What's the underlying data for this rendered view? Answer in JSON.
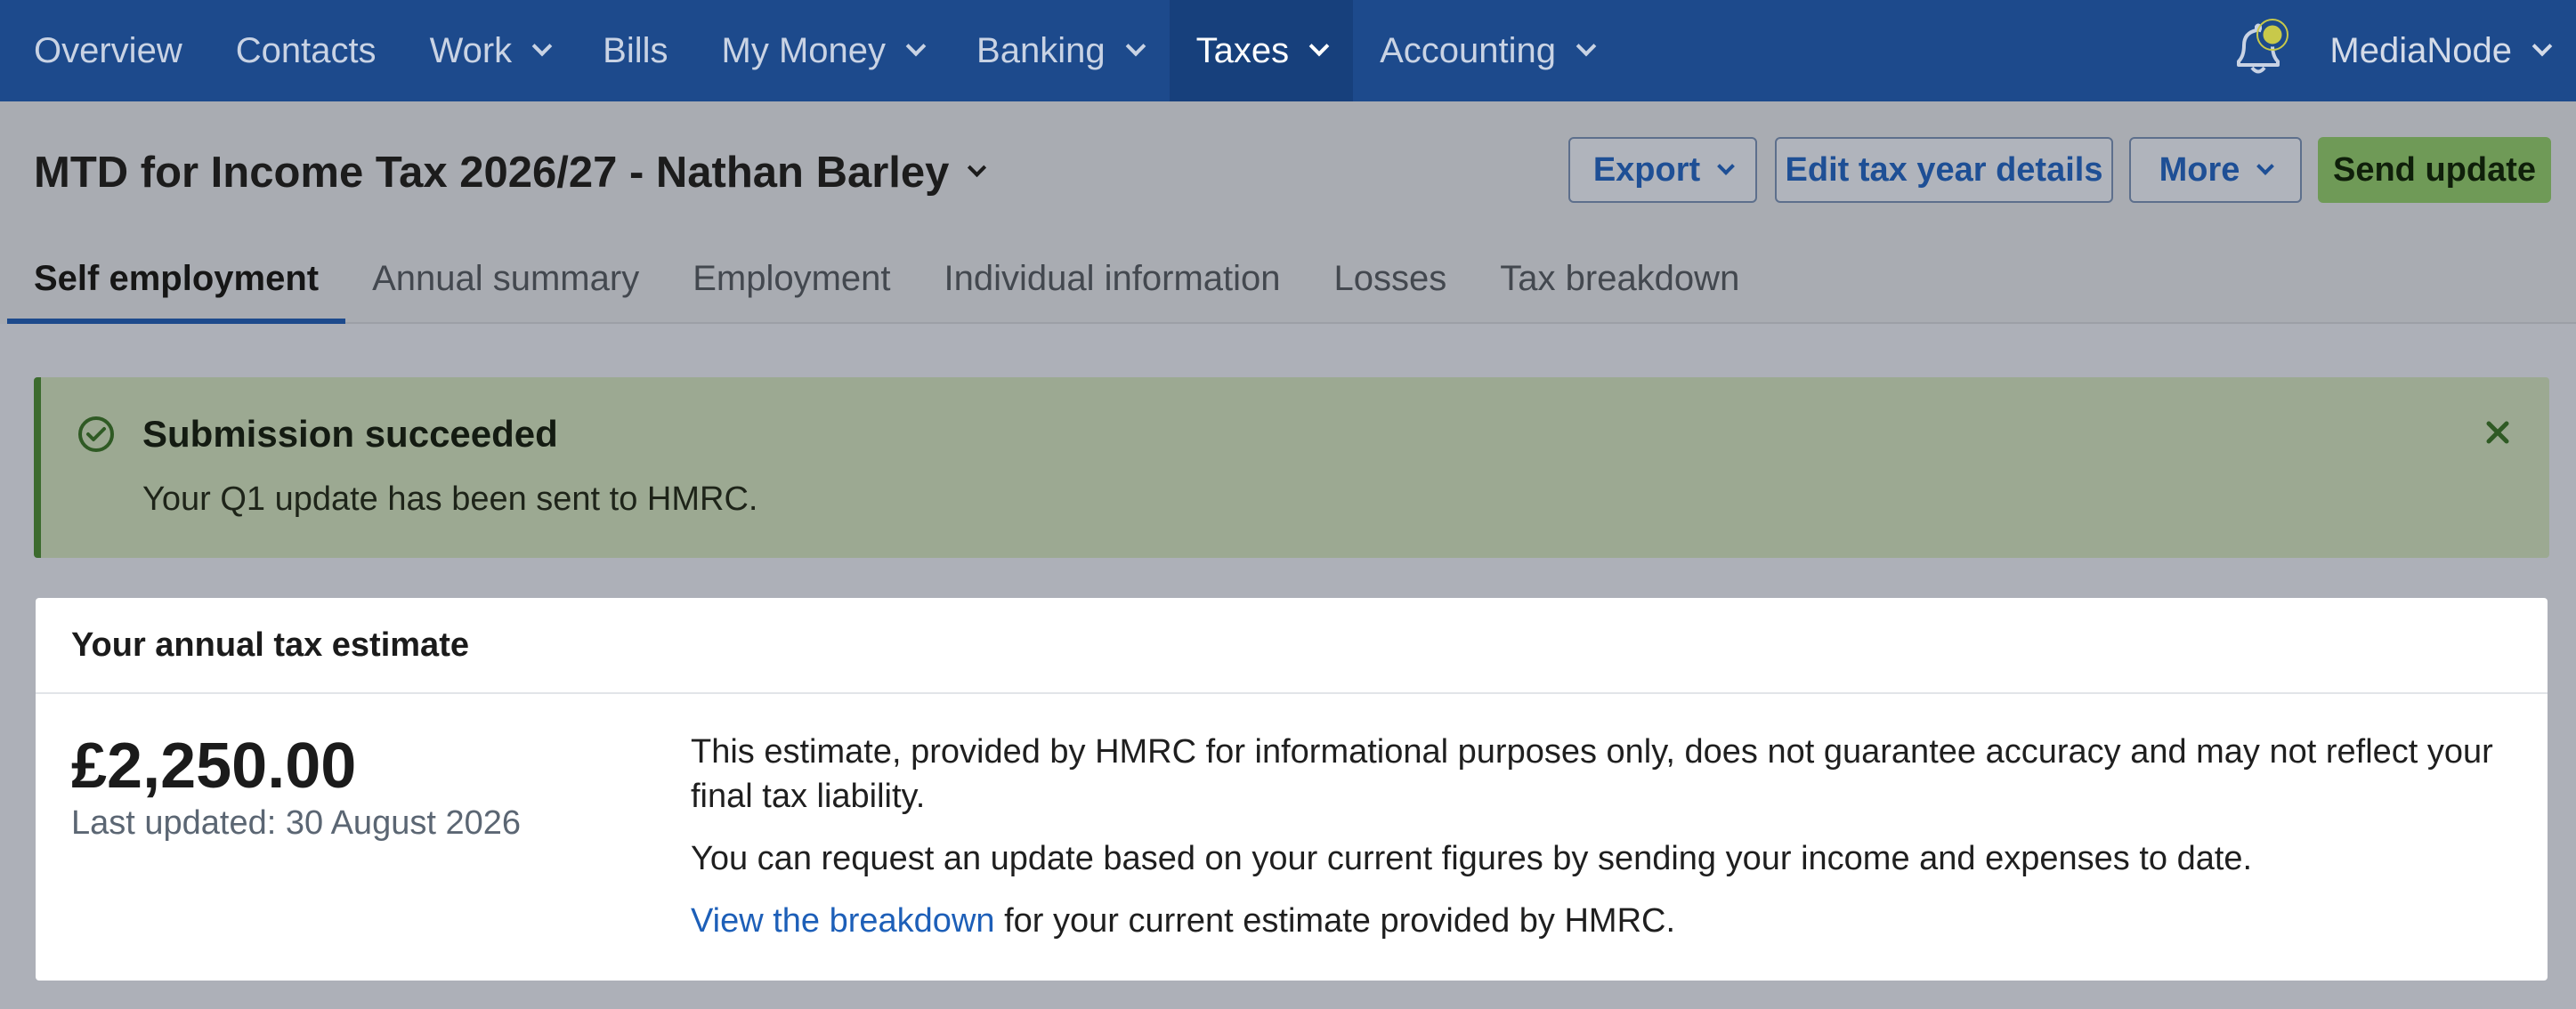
{
  "nav": {
    "items": [
      {
        "label": "Overview",
        "dropdown": false
      },
      {
        "label": "Contacts",
        "dropdown": false
      },
      {
        "label": "Work",
        "dropdown": true
      },
      {
        "label": "Bills",
        "dropdown": false
      },
      {
        "label": "My Money",
        "dropdown": true
      },
      {
        "label": "Banking",
        "dropdown": true
      },
      {
        "label": "Taxes",
        "dropdown": true,
        "active": true
      },
      {
        "label": "Accounting",
        "dropdown": true
      }
    ],
    "org_name": "MediaNode",
    "notification_icon": "bell-icon"
  },
  "header": {
    "title": "MTD for Income Tax 2026/27 - Nathan Barley",
    "export_label": "Export",
    "edit_label": "Edit tax year details",
    "more_label": "More",
    "send_label": "Send update"
  },
  "tabs": [
    {
      "label": "Self employment",
      "active": true
    },
    {
      "label": "Annual summary"
    },
    {
      "label": "Employment"
    },
    {
      "label": "Individual information"
    },
    {
      "label": "Losses"
    },
    {
      "label": "Tax breakdown"
    }
  ],
  "alert": {
    "title": "Submission succeeded",
    "message": "Your Q1 update has been sent to HMRC."
  },
  "estimate": {
    "heading": "Your annual tax estimate",
    "amount": "£2,250.00",
    "last_updated": "Last updated: 30 August 2026",
    "disclaimer": "This estimate, provided by HMRC for informational purposes only, does not guarantee accuracy and may not reflect your final tax liability.",
    "request_text": "You can request an update based on your current figures by sending your income and expenses to date.",
    "breakdown_link": "View the breakdown",
    "breakdown_suffix": " for your current estimate provided by HMRC."
  },
  "colors": {
    "nav_bg": "#1d4a8c",
    "primary_button": "#6f9a57",
    "success_border": "#3c6b2e",
    "link": "#1d5fb8"
  }
}
